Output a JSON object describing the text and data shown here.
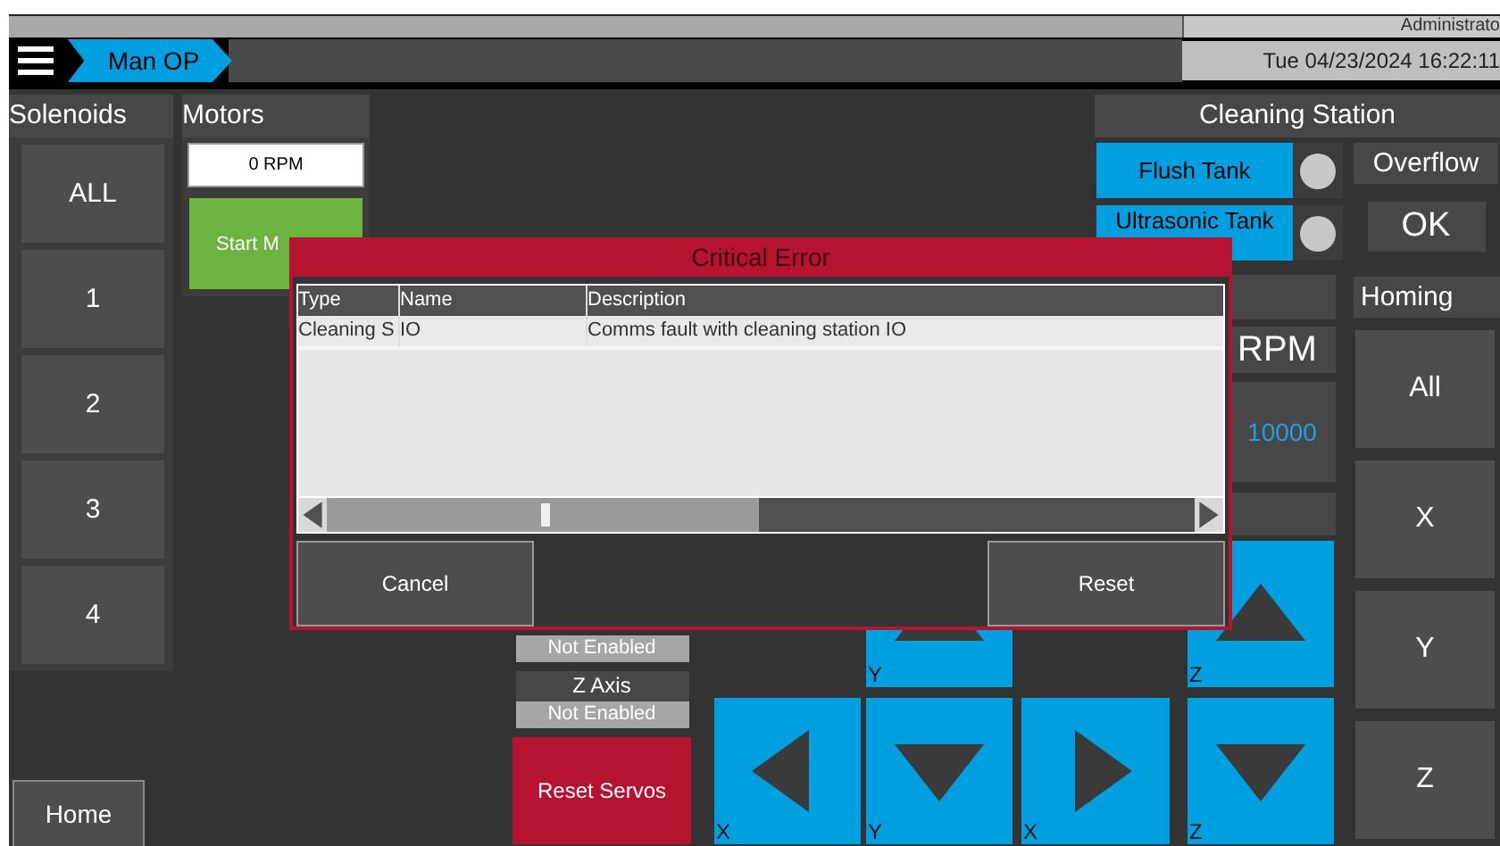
{
  "header": {
    "user": "Administrato",
    "datetime": "Tue 04/23/2024 16:22:11",
    "breadcrumb": [
      {
        "label": "Man OP",
        "selected": true
      }
    ]
  },
  "solenoids": {
    "title": "Solenoids",
    "buttons": [
      "ALL",
      "1",
      "2",
      "3",
      "4"
    ]
  },
  "motors": {
    "title": "Motors",
    "speed_value": "0 RPM",
    "start_button": "Start M"
  },
  "cleaning_station": {
    "title": "Cleaning Station",
    "tanks": [
      {
        "label": "Flush Tank",
        "on": false
      },
      {
        "label": "Ultrasonic Tank",
        "on": false
      }
    ],
    "overflow": {
      "label": "Overflow",
      "status": "OK"
    }
  },
  "spindle": {
    "unit": "RPM",
    "speed": "10000"
  },
  "homing": {
    "title": "Homing",
    "buttons": [
      "All",
      "X",
      "Y",
      "Z"
    ]
  },
  "servos": {
    "axes": [
      {
        "status": "Not Enabled"
      },
      {
        "name": "Z Axis",
        "status": "Not Enabled"
      }
    ],
    "reset_button": "Reset Servos"
  },
  "jog": [
    {
      "axis": "Y",
      "kind": "up"
    },
    {
      "axis": "Z",
      "kind": "up"
    },
    {
      "axis": "X",
      "kind": "left"
    },
    {
      "axis": "Y",
      "kind": "down"
    },
    {
      "axis": "X",
      "kind": "right"
    },
    {
      "axis": "Z",
      "kind": "down"
    }
  ],
  "home_button": "Home",
  "dialog": {
    "title": "Critical Error",
    "columns": [
      "Type",
      "Name",
      "Description"
    ],
    "rows": [
      [
        "Cleaning S",
        "IO",
        "Comms fault with cleaning station IO"
      ]
    ],
    "buttons": [
      "Cancel",
      "Reset"
    ]
  }
}
